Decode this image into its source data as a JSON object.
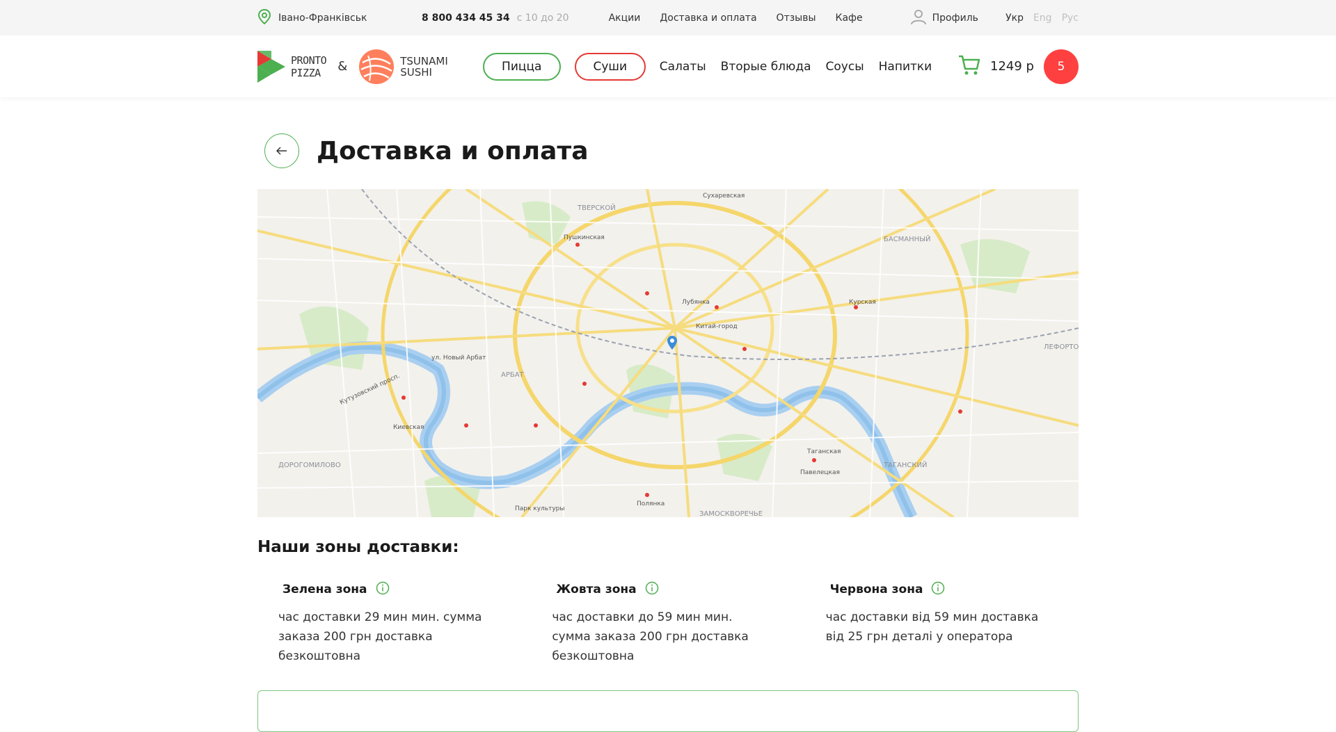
{
  "topbar": {
    "city": "Івано-Франківськ",
    "phone": "8 800 434 45 34",
    "hours": "с 10 до 20",
    "nav": [
      "Акции",
      "Доставка и оплата",
      "Отзывы",
      "Кафе"
    ],
    "profile": "Профиль",
    "langs": [
      "Укр",
      "Eng",
      "Рус"
    ]
  },
  "header": {
    "logo_pronto_line1": "PRONTO",
    "logo_pronto_line2": "PIZZA",
    "amp": "&",
    "logo_sushi_line1": "TSUNAMI",
    "logo_sushi_line2": "SUSHI",
    "pill_pizza": "Пицца",
    "pill_sushi": "Суши",
    "categories": [
      "Салаты",
      "Вторые блюда",
      "Соусы",
      "Напитки"
    ],
    "cart_sum": "1249 р",
    "cart_count": "5"
  },
  "page": {
    "title": "Доставка и оплата"
  },
  "map": {
    "labels": [
      "ТВЕРСКОЙ",
      "БАСМАННЫЙ",
      "АРБАТ",
      "ТАГАНСКИЙ",
      "ДОРОГОМИЛОВО",
      "ЗАМОСКВОРЕЧЬЕ",
      "ЛЕФОРТОВО",
      "ул. Новый Арбат",
      "Кутузовский просп.",
      "Пушкинская",
      "Лубянка",
      "Китай-город",
      "Сухаревская",
      "Курская",
      "Киевская",
      "Парк культуры",
      "Полянка",
      "Таганская",
      "Павелецкая"
    ]
  },
  "zones": {
    "title": "Наши зоны доставки:",
    "items": [
      {
        "name": "Зелена зона",
        "desc": "час доставки 29 мин мин. сумма заказа 200 грн доставка безкоштовна"
      },
      {
        "name": "Жовта зона",
        "desc": "час доставки до 59 мин мин. сумма заказа 200 грн доставка безкоштовна"
      },
      {
        "name": "Червона зона",
        "desc": "час доставки від 59 мин доставка від 25 грн деталі у оператора"
      }
    ]
  },
  "colors": {
    "green": "#4caf50",
    "red": "#e53935",
    "cart_badge": "#ff4040"
  }
}
